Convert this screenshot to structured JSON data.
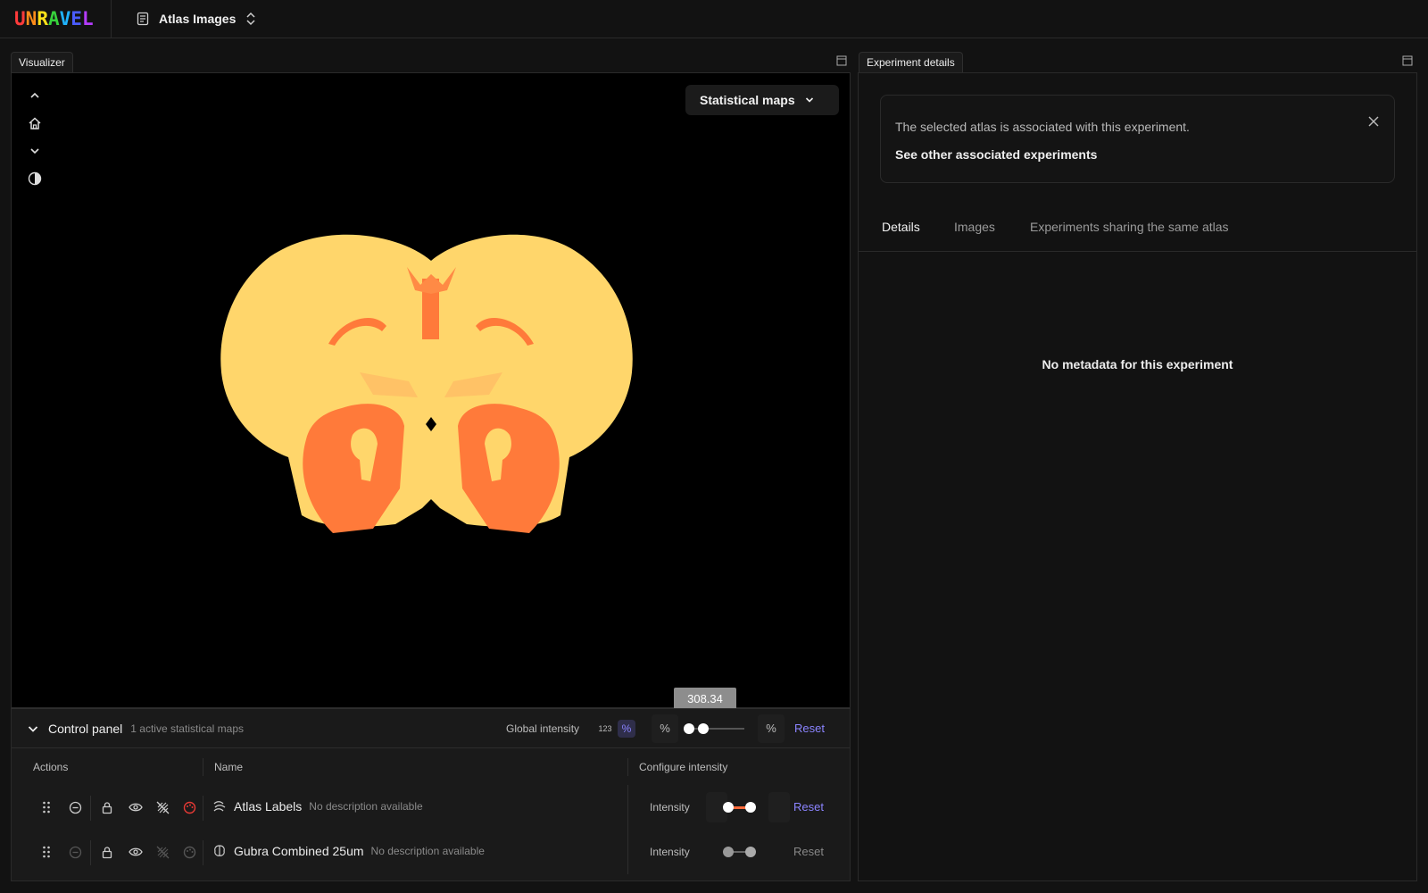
{
  "app": {
    "logo_letters": [
      "U",
      "N",
      "R",
      "A",
      "V",
      "E",
      "L"
    ],
    "logo_colors": [
      "#ff3b3b",
      "#ff8c1a",
      "#ffe11a",
      "#37d23c",
      "#1fb3ff",
      "#4a5cff",
      "#b43cff"
    ],
    "project_name": "Atlas Images"
  },
  "visualizer": {
    "tab_label": "Visualizer",
    "stat_maps_button": "Statistical maps",
    "tools": [
      "chevron-up-icon",
      "home-icon",
      "chevron-down-icon",
      "contrast-icon"
    ],
    "colors": {
      "atlas_fill": "#ffd66b",
      "label_fill": "#ff7a3a",
      "label_fill_light": "#ffc266"
    }
  },
  "tooltip_value": "308.34",
  "control_panel": {
    "title": "Control panel",
    "subtitle": "1 active statistical maps",
    "global_intensity_label": "Global intensity",
    "mode_raw_label": "123",
    "mode_pct_label": "%",
    "pct_left": "%",
    "pct_right": "%",
    "reset_label": "Reset",
    "columns": {
      "actions": "Actions",
      "name": "Name",
      "configure": "Configure intensity"
    },
    "rows": [
      {
        "name": "Atlas Labels",
        "description": "No description available",
        "intensity_label": "Intensity",
        "reset": "Reset",
        "active": true
      },
      {
        "name": "Gubra Combined 25um",
        "description": "No description available",
        "intensity_label": "Intensity",
        "reset": "Reset",
        "active": false
      }
    ]
  },
  "details": {
    "tab_label": "Experiment details",
    "notice_text": "The selected atlas is associated with this experiment.",
    "notice_link": "See other associated experiments",
    "tabs": [
      "Details",
      "Images",
      "Experiments sharing the same atlas"
    ],
    "selected_tab": "Details",
    "empty_text": "No metadata for this experiment"
  },
  "accent_color": "#8b84ff"
}
